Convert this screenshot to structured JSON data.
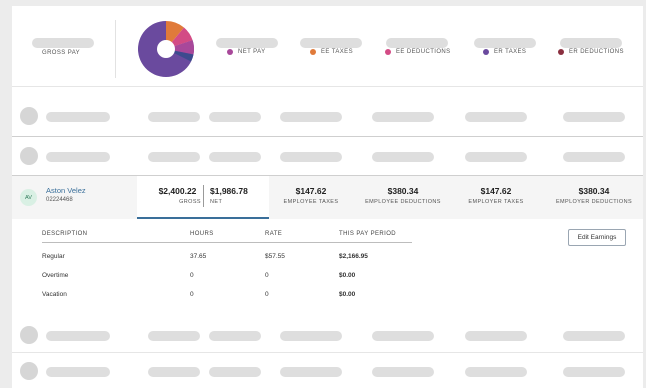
{
  "summary": {
    "gross_label": "GROSS PAY",
    "legend": [
      {
        "label": "NET PAY",
        "color": "#a8489a"
      },
      {
        "label": "EE TAXES",
        "color": "#e07a3a"
      },
      {
        "label": "EE DEDUCTIONS",
        "color": "#d34b85"
      },
      {
        "label": "ER TAXES",
        "color": "#6a4a9e"
      },
      {
        "label": "ER DEDUCTIONS",
        "color": "#8a2f3f"
      }
    ]
  },
  "employee": {
    "initials": "AV",
    "name": "Aston Velez",
    "id": "02224468",
    "gross_value": "$2,400.22",
    "gross_label": "GROSS",
    "net_value": "$1,986.78",
    "net_label": "NET",
    "metrics": [
      {
        "value": "$147.62",
        "label": "EMPLOYEE TAXES"
      },
      {
        "value": "$380.34",
        "label": "EMPLOYEE DEDUCTIONS"
      },
      {
        "value": "$147.62",
        "label": "EMPLOYER TAXES"
      },
      {
        "value": "$380.34",
        "label": "EMPLOYER DEDUCTIONS"
      }
    ]
  },
  "earnings": {
    "columns": [
      "DESCRIPTION",
      "HOURS",
      "RATE",
      "THIS PAY PERIOD"
    ],
    "rows": [
      {
        "description": "Regular",
        "hours": "37.65",
        "rate": "$57.55",
        "amount": "$2,166.95"
      },
      {
        "description": "Overtime",
        "hours": "0",
        "rate": "0",
        "amount": "$0.00"
      },
      {
        "description": "Vacation",
        "hours": "0",
        "rate": "0",
        "amount": "$0.00"
      }
    ],
    "edit_label": "Edit Earnings"
  }
}
